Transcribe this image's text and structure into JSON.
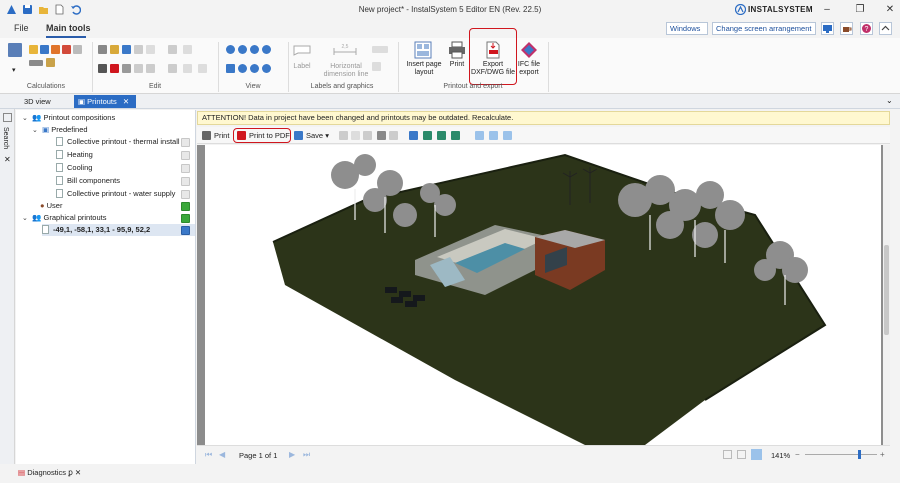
{
  "window": {
    "title": "New project* - InstalSystem 5 Editor EN (Rev. 22.5)",
    "brand": "INSTALSYSTEM"
  },
  "menu": {
    "file": "File",
    "main_tools": "Main tools"
  },
  "top_right": {
    "windows_combo": "Windows",
    "arrangement_combo": "Change screen arrangement"
  },
  "ribbon": {
    "groups": {
      "calculations": "Calculations",
      "edit": "Edit",
      "view": "View",
      "labels_graphics": "Labels and graphics",
      "printout_export": "Printout and export"
    },
    "buttons": {
      "label": "Label",
      "horizontal_dimension_line": "Horizontal dimension line",
      "insert_page_layout": "Insert page layout",
      "print": "Print",
      "export_dxf_dwg": "Export DXF/DWG file",
      "ifc_export": "IFC file export"
    }
  },
  "tabs": {
    "view_3d": "3D view",
    "printouts": "Printouts"
  },
  "side_strip": {
    "label": "Search"
  },
  "tree": {
    "printout_compositions": "Printout compositions",
    "predefined": "Predefined",
    "predefined_items": [
      "Collective printout - thermal install",
      "Heating",
      "Cooling",
      "Bill components",
      "Collective printout - water supply"
    ],
    "user": "User",
    "graphical_printouts": "Graphical printouts",
    "graphical_item": "-49,1, -58,1, 33,1 -  95,9, 52,2"
  },
  "attention": "ATTENTION! Data in project have been changed and printouts may be outdated. Recalculate.",
  "print_toolbar": {
    "print": "Print",
    "print_to_pdf": "Print to PDF",
    "save": "Save"
  },
  "status": {
    "page": "Page 1 of 1",
    "zoom": "141%"
  },
  "bottom": {
    "diagnostics": "Diagnostics"
  },
  "colors": {
    "accent": "#2b6cc4",
    "highlight_frame": "#d0161e",
    "warning_bg": "#fff8d0"
  }
}
